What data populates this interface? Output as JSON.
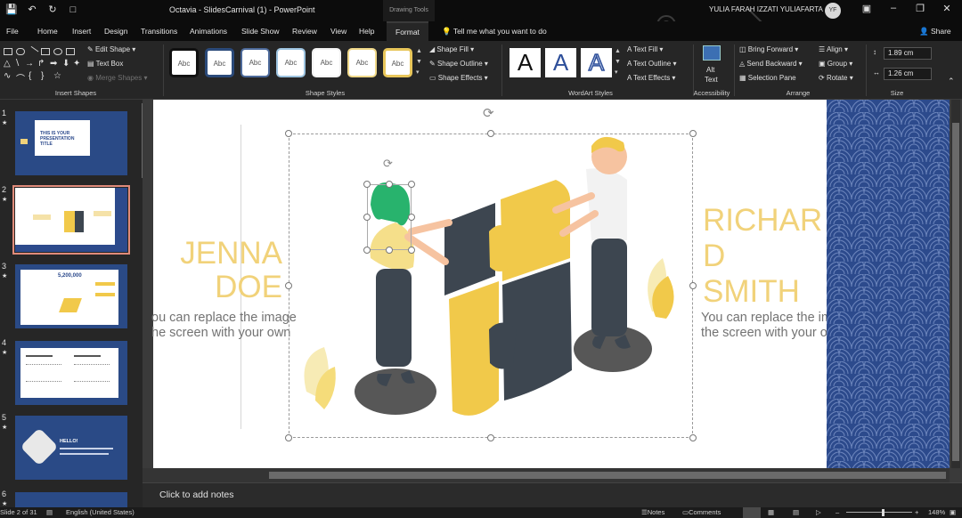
{
  "titlebar": {
    "title": "Octavia - SlidesCarnival (1)  -  PowerPoint",
    "context_tab": "Drawing Tools",
    "user": "YULIA FARAH IZZATI YULIAFARTA",
    "avatar_initials": "YF"
  },
  "tabs": {
    "items": [
      "File",
      "Home",
      "Insert",
      "Design",
      "Transitions",
      "Animations",
      "Slide Show",
      "Review",
      "View",
      "Help",
      "Format"
    ],
    "tell_me": "Tell me what you want to do",
    "share": "Share"
  },
  "ribbon": {
    "insert_shapes": {
      "edit_shape": "Edit Shape",
      "text_box": "Text Box",
      "merge_shapes": "Merge Shapes",
      "label": "Insert Shapes"
    },
    "shape_styles": {
      "swatch_text": "Abc",
      "shape_fill": "Shape Fill",
      "shape_outline": "Shape Outline",
      "shape_effects": "Shape Effects",
      "label": "Shape Styles"
    },
    "wordart": {
      "text_fill": "Text Fill",
      "text_outline": "Text Outline",
      "text_effects": "Text Effects",
      "label": "WordArt Styles",
      "letter": "A"
    },
    "accessibility": {
      "alt_text_1": "Alt",
      "alt_text_2": "Text",
      "label": "Accessibility"
    },
    "arrange": {
      "bring_forward": "Bring Forward",
      "send_backward": "Send Backward",
      "selection_pane": "Selection Pane",
      "align": "Align",
      "group": "Group",
      "rotate": "Rotate",
      "label": "Arrange"
    },
    "size": {
      "height": "1.89 cm",
      "width": "1.26 cm",
      "label": "Size"
    }
  },
  "thumbnails": [
    {
      "num": "1",
      "star": "★",
      "text": "THIS IS YOUR PRESENTATION TITLE"
    },
    {
      "num": "2",
      "star": "★"
    },
    {
      "num": "3",
      "star": "★",
      "text": "5,200,000"
    },
    {
      "num": "4",
      "star": "★"
    },
    {
      "num": "5",
      "star": "★",
      "text": "HELLO!"
    },
    {
      "num": "6",
      "star": "★"
    }
  ],
  "slide": {
    "left_name_line1": "JENNA",
    "left_name_line2": "DOE",
    "left_desc_line1": "ou can replace the image",
    "left_desc_line2": "he screen with your own",
    "right_name_line1": "RICHAR",
    "right_name_line2": "D",
    "right_name_line3": "SMITH",
    "right_desc_line1": "You can replace the image on",
    "right_desc_line2": "the screen with your own"
  },
  "notes": {
    "placeholder": "Click to add notes"
  },
  "status": {
    "slide_info": "Slide 2 of 31",
    "language": "English (United States)",
    "notes_btn": "Notes",
    "comments_btn": "Comments",
    "zoom": "148%"
  },
  "colors": {
    "accent_yellow": "#f1d27a",
    "pattern_blue": "#2c4a8c",
    "dark_bg": "#262626"
  }
}
